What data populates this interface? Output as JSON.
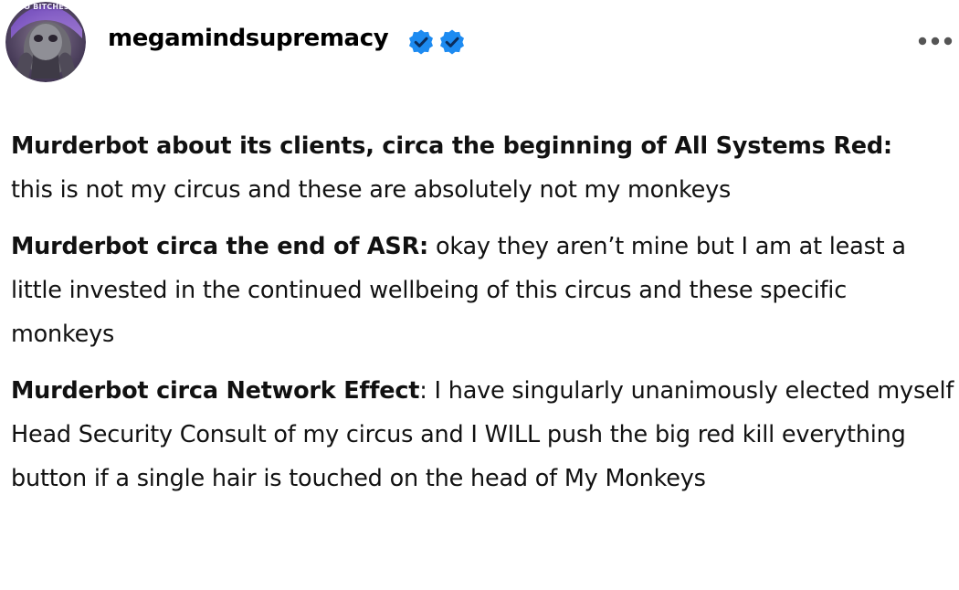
{
  "post": {
    "author": {
      "username": "megamindsupremacy",
      "avatar_caption": "NO BITCHES?",
      "badges": [
        "verified-badge-icon",
        "verified-badge-icon"
      ]
    },
    "menu_icon": "more-options-icon",
    "paragraphs": [
      {
        "bold": "Murderbot about its clients, circa the beginning of All Systems Red:",
        "text": "this is not my circus and these are absolutely not my monkeys"
      },
      {
        "bold": "Murderbot circa the end of ASR:",
        "text": "okay they aren’t mine but I am at least a little invested in the continued wellbeing of this circus and these specific monkeys"
      },
      {
        "bold": "Murderbot circa Network Effect",
        "text": ": I have singularly unanimously elected myself Head Security Consult of my circus and I WILL push the big red kill everything button if a single hair is touched on the head of My Monkeys"
      }
    ]
  },
  "colors": {
    "badge_blue": "#1d8bf1",
    "text": "#111111",
    "menu_dots": "#555555"
  }
}
